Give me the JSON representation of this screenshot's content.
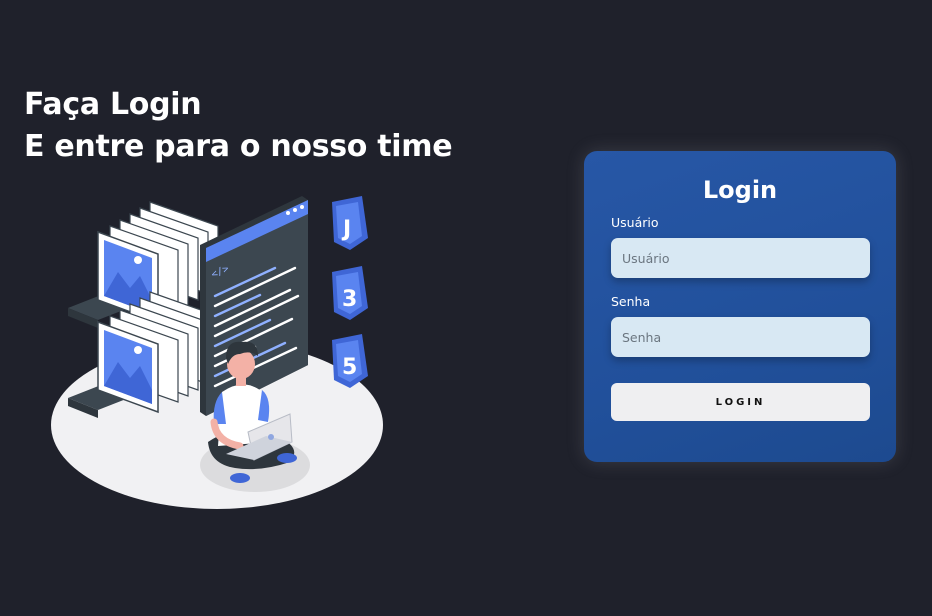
{
  "hero": {
    "line1": "Faça Login",
    "line2": "E entre para o nosso time"
  },
  "illustration": {
    "badges": [
      "J",
      "3",
      "5"
    ],
    "code_tag": "</>"
  },
  "login_card": {
    "title": "Login",
    "username_label": "Usuário",
    "username_placeholder": "Usuário",
    "username_value": "",
    "password_label": "Senha",
    "password_placeholder": "Senha",
    "password_value": "",
    "button_label": "LOGIN"
  },
  "colors": {
    "background": "#1f212b",
    "card": "#2455a1",
    "input": "#d8e8f3",
    "button": "#efeff1",
    "accent_blue": "#5a84f0"
  }
}
